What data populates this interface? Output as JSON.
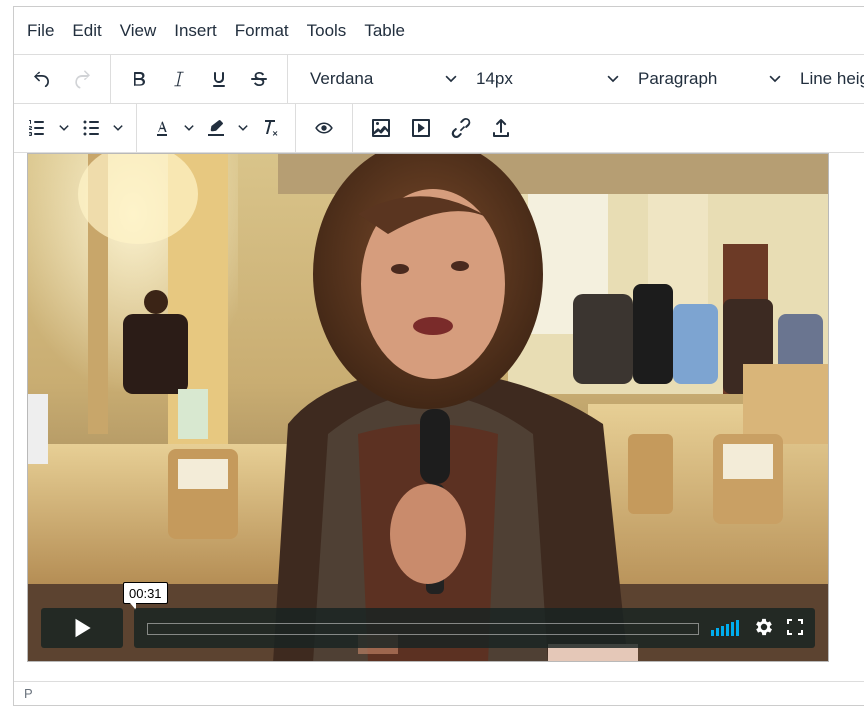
{
  "menubar": {
    "items": [
      "File",
      "Edit",
      "View",
      "Insert",
      "Format",
      "Tools",
      "Table"
    ]
  },
  "toolbar": {
    "font_family": "Verdana",
    "font_size": "14px",
    "block_format": "Paragraph",
    "line_height": "Line height"
  },
  "video": {
    "timestamp": "00:31",
    "progress": 0.0,
    "volume_level": 1.0
  },
  "statusbar": {
    "path": "P"
  },
  "colors": {
    "accent": "#00adef",
    "icon": "#222f3e",
    "disabled_icon": "#9a9fa6"
  }
}
